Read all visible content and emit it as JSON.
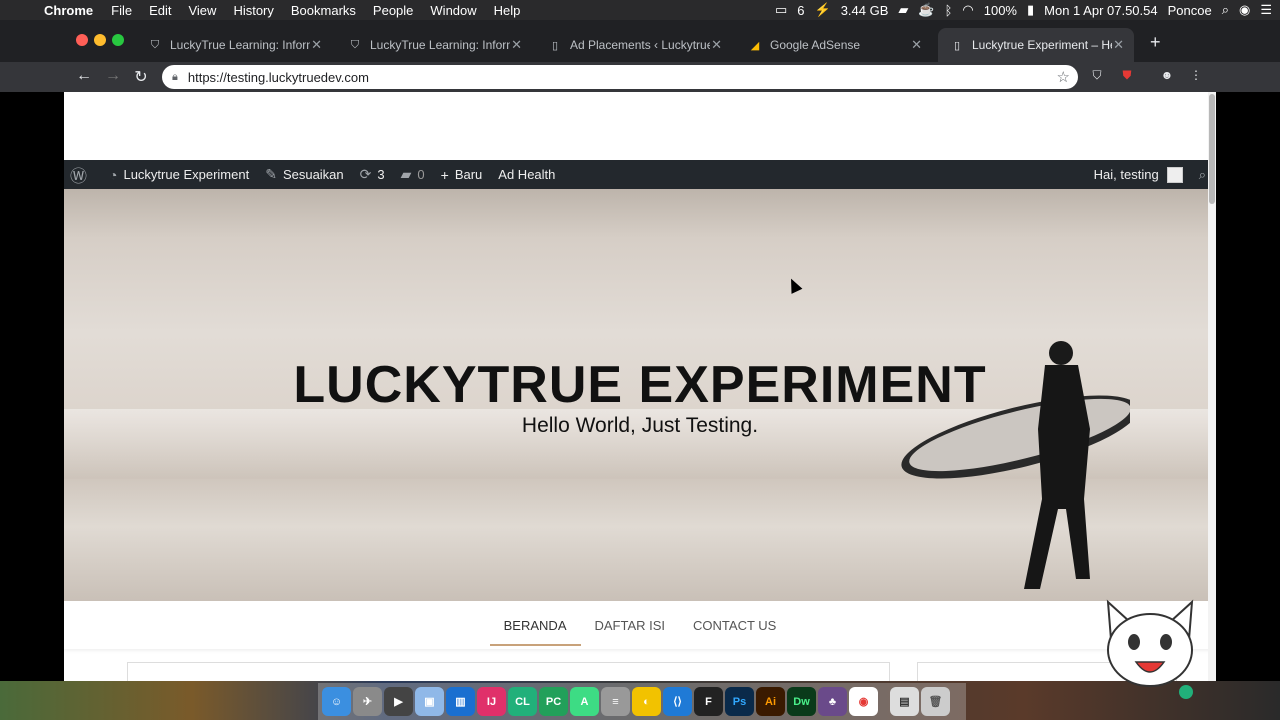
{
  "menubar": {
    "app": "Chrome",
    "items": [
      "File",
      "Edit",
      "View",
      "History",
      "Bookmarks",
      "People",
      "Window",
      "Help"
    ],
    "status": {
      "count": "6",
      "memory": "3.44 GB",
      "battery": "100%",
      "clock": "Mon 1 Apr  07.50.54",
      "user": "Poncoe"
    }
  },
  "tabs": [
    {
      "title": "LuckyTrue Learning: Informa",
      "icon": "shield-icon"
    },
    {
      "title": "LuckyTrue Learning: Informa",
      "icon": "shield-icon"
    },
    {
      "title": "Ad Placements ‹ Luckytrue",
      "icon": "page-icon"
    },
    {
      "title": "Google AdSense",
      "icon": "adsense-icon"
    },
    {
      "title": "Luckytrue Experiment – Hell",
      "icon": "page-icon"
    }
  ],
  "omnibox": {
    "url": "https://testing.luckytruedev.com"
  },
  "adminbar": {
    "site": "Luckytrue Experiment",
    "customize": "Sesuaikan",
    "updates": "3",
    "comments": "0",
    "new": "Baru",
    "adhealth": "Ad Health",
    "greeting": "Hai, testing"
  },
  "hero": {
    "title": "LUCKYTRUE EXPERIMENT",
    "tagline": "Hello World, Just Testing."
  },
  "nav": [
    "BERANDA",
    "DAFTAR ISI",
    "CONTACT US"
  ],
  "colors": {
    "nav_active_underline": "#c8a27a",
    "adminbar_bg": "#23282d"
  }
}
